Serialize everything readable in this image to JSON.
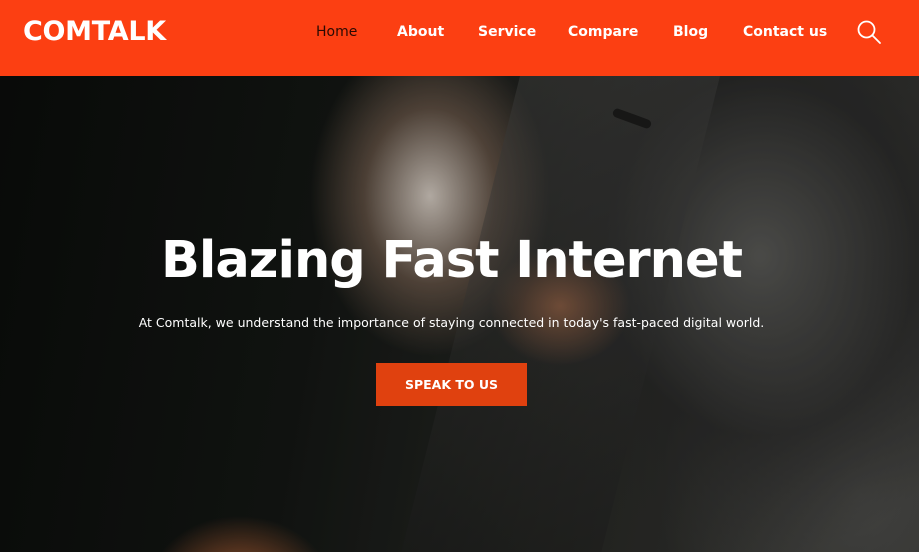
{
  "brand": {
    "logo_text": "COMTALK",
    "accent_color": "#fc3f12"
  },
  "nav": {
    "items": [
      {
        "label": "Home",
        "active": true
      },
      {
        "label": "About",
        "active": false
      },
      {
        "label": "Service",
        "active": false
      },
      {
        "label": "Compare",
        "active": false
      },
      {
        "label": "Blog",
        "active": false
      },
      {
        "label": "Contact us",
        "active": false
      }
    ],
    "search_icon": "search-icon"
  },
  "hero": {
    "title": "Blazing Fast Internet",
    "subtitle": "At Comtalk, we understand the importance of staying connected in today's fast-paced digital world.",
    "cta_label": "SPEAK TO US",
    "cta_color": "#e0410f"
  }
}
